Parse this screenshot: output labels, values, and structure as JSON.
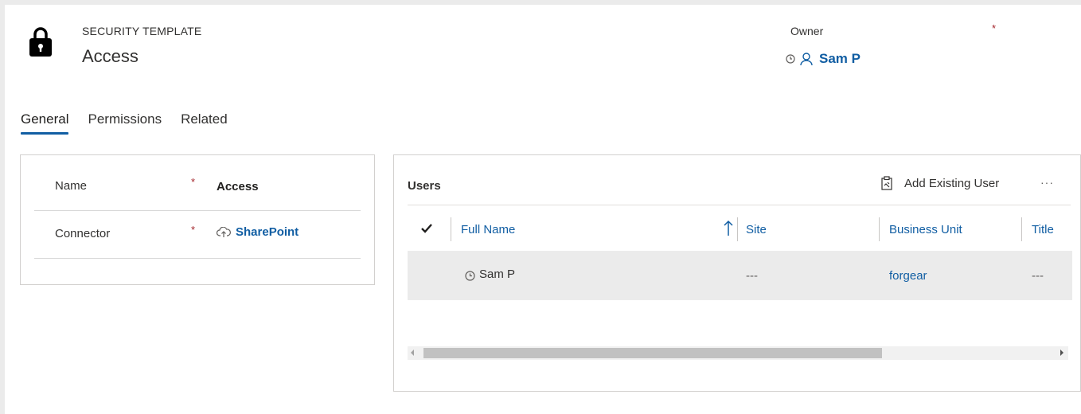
{
  "header": {
    "entity_type": "SECURITY TEMPLATE",
    "record_name": "Access",
    "owner_label": "Owner",
    "owner_required": "*",
    "owner_name": "Sam P",
    "icons": [
      "lock-icon",
      "clock-icon",
      "person-icon"
    ]
  },
  "tabs": [
    {
      "label": "General",
      "active": true
    },
    {
      "label": "Permissions",
      "active": false
    },
    {
      "label": "Related",
      "active": false
    }
  ],
  "general_form": {
    "fields": [
      {
        "label": "Name",
        "required": "*",
        "value": "Access"
      },
      {
        "label": "Connector",
        "required": "*",
        "value": "SharePoint",
        "icon": "cloud-icon"
      }
    ]
  },
  "users_grid": {
    "title": "Users",
    "add_existing_label": "Add Existing User",
    "more_label": "···",
    "columns": [
      "Full Name",
      "Site",
      "Business Unit",
      "Title"
    ],
    "sort_indicator": "↑",
    "rows": [
      {
        "full_name": "Sam P",
        "site": "---",
        "business_unit": "forgear",
        "title": "---"
      }
    ]
  },
  "colors": {
    "accent": "#115ea3",
    "required": "#a4262c",
    "selected_row": "#ebebeb"
  }
}
